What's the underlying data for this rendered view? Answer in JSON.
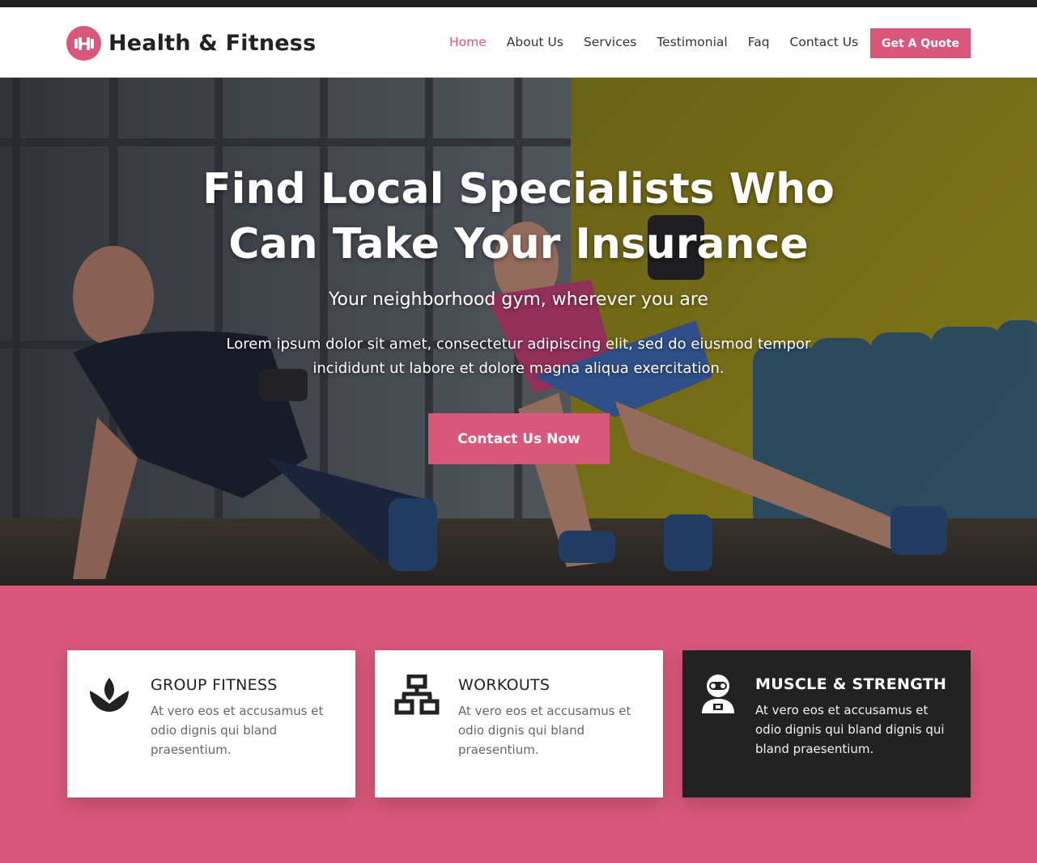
{
  "brand": {
    "name": "Health & Fitness",
    "icon": "dumbbell-icon",
    "accent_color": "#d9577a",
    "dark_color": "#222222"
  },
  "nav": {
    "items": [
      {
        "label": "Home",
        "active": true
      },
      {
        "label": "About Us",
        "active": false
      },
      {
        "label": "Services",
        "active": false
      },
      {
        "label": "Testimonial",
        "active": false
      },
      {
        "label": "Faq",
        "active": false
      },
      {
        "label": "Contact Us",
        "active": false
      }
    ],
    "cta_label": "Get A Quote"
  },
  "hero": {
    "title_line1": "Find Local Specialists Who",
    "title_line2": "Can Take Your Insurance",
    "subtitle": "Your neighborhood gym, wherever you are",
    "body_line1": "Lorem ipsum dolor sit amet, consectetur adipiscing elit, sed do eiusmod tempor",
    "body_line2": "incididunt ut labore et dolore magna aliqua exercitation.",
    "button_label": "Contact Us Now"
  },
  "features": [
    {
      "icon": "lotus-icon",
      "title": "GROUP FITNESS",
      "text": "At vero eos et accusamus et odio dignis qui bland praesentium.",
      "dark": false
    },
    {
      "icon": "network-icon",
      "title": "WORKOUTS",
      "text": "At vero eos et accusamus et odio dignis qui bland praesentium.",
      "dark": false
    },
    {
      "icon": "trainer-icon",
      "title": "MUSCLE & STRENGTH",
      "text": "At vero eos et accusamus et odio dignis qui bland dignis qui bland praesentium.",
      "dark": true
    }
  ]
}
